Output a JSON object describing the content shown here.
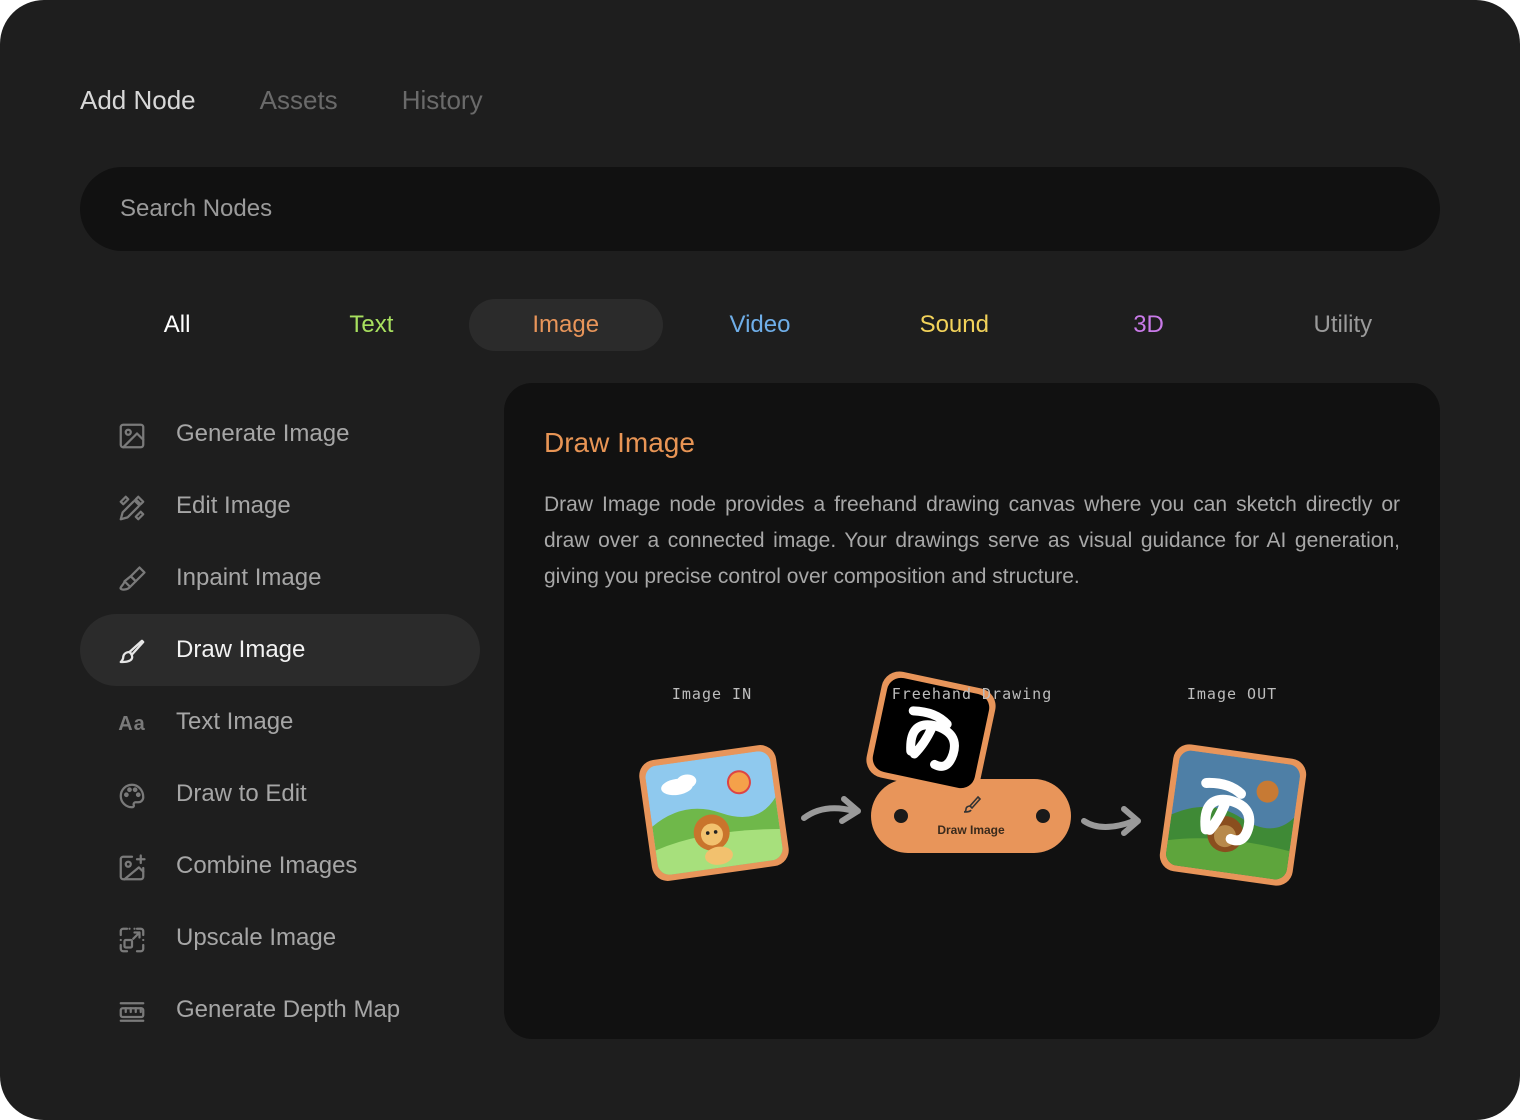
{
  "tabs": [
    {
      "label": "Add Node",
      "active": true
    },
    {
      "label": "Assets",
      "active": false
    },
    {
      "label": "History",
      "active": false
    }
  ],
  "search": {
    "placeholder": "Search Nodes"
  },
  "categories": [
    {
      "label": "All",
      "color": "#ffffff"
    },
    {
      "label": "Text",
      "color": "#a8e05f"
    },
    {
      "label": "Image",
      "color": "#e8955a",
      "active": true
    },
    {
      "label": "Video",
      "color": "#6faee8"
    },
    {
      "label": "Sound",
      "color": "#f2d25a"
    },
    {
      "label": "3D",
      "color": "#c97ae8"
    },
    {
      "label": "Utility",
      "color": "#9a9a9a"
    }
  ],
  "nodes": [
    {
      "label": "Generate Image",
      "icon": "image-icon"
    },
    {
      "label": "Edit Image",
      "icon": "pencil-ruler-icon"
    },
    {
      "label": "Inpaint Image",
      "icon": "paint-brush-icon"
    },
    {
      "label": "Draw Image",
      "icon": "brush-icon",
      "active": true
    },
    {
      "label": "Text Image",
      "icon": "Aa"
    },
    {
      "label": "Draw to Edit",
      "icon": "palette-icon"
    },
    {
      "label": "Combine Images",
      "icon": "image-plus-icon"
    },
    {
      "label": "Upscale Image",
      "icon": "upscale-icon"
    },
    {
      "label": "Generate Depth Map",
      "icon": "depth-map-icon"
    }
  ],
  "detail": {
    "title": "Draw Image",
    "description": "Draw Image node provides a freehand drawing canvas where you can sketch directly or draw over a connected image. Your drawings serve as visual guidance for AI generation, giving you precise control over composition and structure.",
    "node_label": "Draw Image",
    "captions": [
      "Image IN",
      "Freehand Drawing",
      "Image OUT"
    ],
    "accent": "#e89555"
  }
}
